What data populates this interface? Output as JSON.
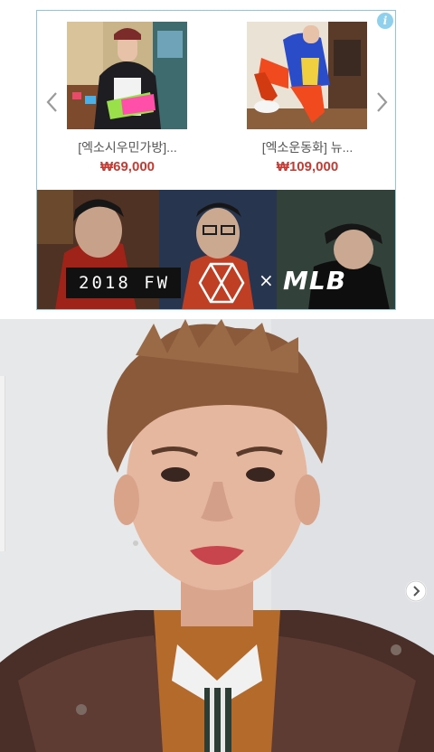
{
  "ad": {
    "info_icon": "i",
    "products": [
      {
        "name": "[엑소시우민가방]...",
        "price": "₩69,000"
      },
      {
        "name": "[엑소운동화] 뉴...",
        "price": "₩109,000"
      }
    ],
    "banner": {
      "year_text": "2018 FW",
      "separator": "×",
      "brand": "MLB"
    }
  },
  "colors": {
    "ad_border": "#8fc7d8",
    "price": "#c33b32",
    "info_badge": "#8fd0ec"
  }
}
